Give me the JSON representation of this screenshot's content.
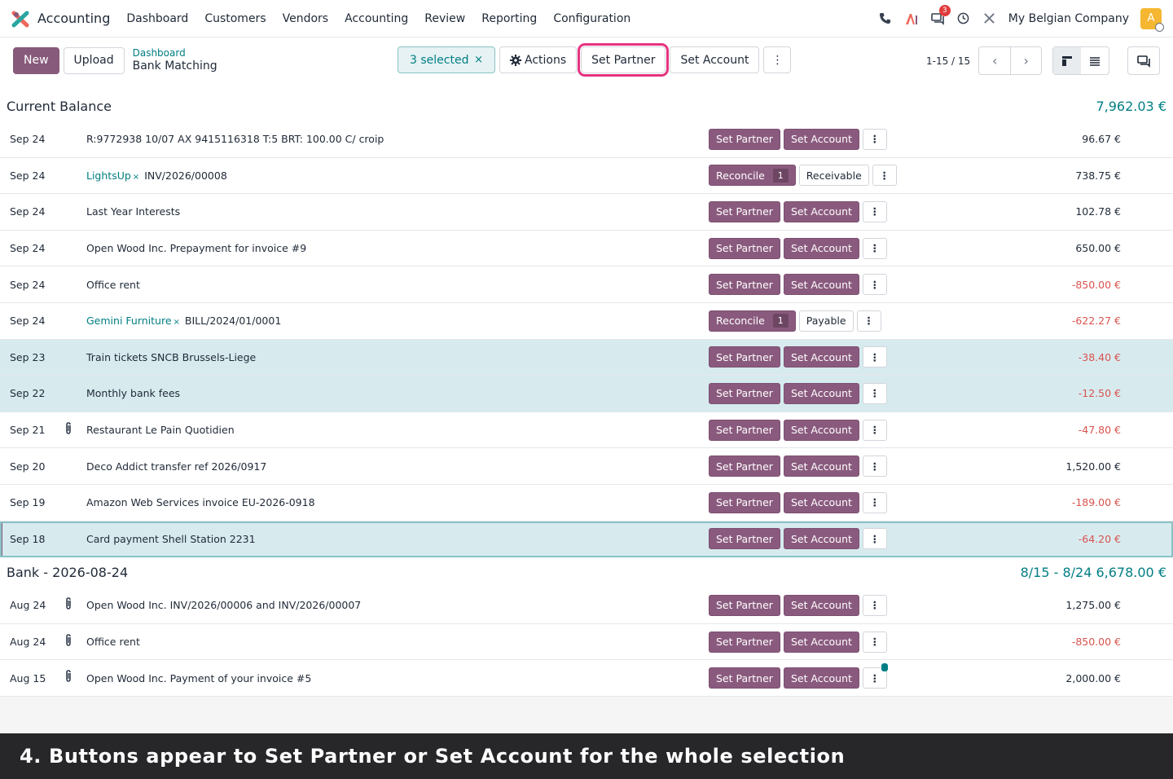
{
  "navbar": {
    "app_name": "Accounting",
    "menu": [
      "Dashboard",
      "Customers",
      "Vendors",
      "Accounting",
      "Review",
      "Reporting",
      "Configuration"
    ],
    "message_badge": "3",
    "company": "My Belgian Company",
    "avatar_letter": "A"
  },
  "controls": {
    "new_label": "New",
    "upload_label": "Upload",
    "breadcrumb_parent": "Dashboard",
    "breadcrumb_current": "Bank Matching",
    "selected_label": "3 selected",
    "selected_clear": "×",
    "actions_label": "Actions",
    "set_partner_label": "Set Partner",
    "set_account_label": "Set Account",
    "pager_text": "1-15 / 15"
  },
  "sections": [
    {
      "title": "Current Balance",
      "amount": "7,962.03 €",
      "rows": [
        {
          "date": "Sep 24",
          "attach": false,
          "partner": "",
          "label": "R:9772938 10/07 AX 9415116318 T:5 BRT: 100.00 C/ croip",
          "mode": "set",
          "amount": "96.67 €",
          "neg": false,
          "selected": false
        },
        {
          "date": "Sep 24",
          "attach": false,
          "partner": "LightsUp",
          "label": "INV/2026/00008",
          "mode": "reconcile",
          "count": "1",
          "account": "Receivable",
          "amount": "738.75 €",
          "neg": false,
          "selected": false
        },
        {
          "date": "Sep 24",
          "attach": false,
          "partner": "",
          "label": "Last Year Interests",
          "mode": "set",
          "amount": "102.78 €",
          "neg": false,
          "selected": false
        },
        {
          "date": "Sep 24",
          "attach": false,
          "partner": "",
          "label": "Open Wood Inc. Prepayment for invoice #9",
          "mode": "set",
          "amount": "650.00 €",
          "neg": false,
          "selected": false
        },
        {
          "date": "Sep 24",
          "attach": false,
          "partner": "",
          "label": "Office rent",
          "mode": "set",
          "amount": "-850.00 €",
          "neg": true,
          "selected": false
        },
        {
          "date": "Sep 24",
          "attach": false,
          "partner": "Gemini Furniture",
          "label": "BILL/2024/01/0001",
          "mode": "reconcile",
          "count": "1",
          "account": "Payable",
          "amount": "-622.27 €",
          "neg": true,
          "selected": false
        },
        {
          "date": "Sep 23",
          "attach": false,
          "partner": "",
          "label": "Train tickets SNCB Brussels-Liege",
          "mode": "set",
          "amount": "-38.40 €",
          "neg": true,
          "selected": true
        },
        {
          "date": "Sep 22",
          "attach": false,
          "partner": "",
          "label": "Monthly bank fees",
          "mode": "set",
          "amount": "-12.50 €",
          "neg": true,
          "selected": true
        },
        {
          "date": "Sep 21",
          "attach": true,
          "partner": "",
          "label": "Restaurant Le Pain Quotidien",
          "mode": "set",
          "amount": "-47.80 €",
          "neg": true,
          "selected": false
        },
        {
          "date": "Sep 20",
          "attach": false,
          "partner": "",
          "label": "Deco Addict transfer ref 2026/0917",
          "mode": "set",
          "amount": "1,520.00 €",
          "neg": false,
          "selected": false
        },
        {
          "date": "Sep 19",
          "attach": false,
          "partner": "",
          "label": "Amazon Web Services invoice EU-2026-0918",
          "mode": "set",
          "amount": "-189.00 €",
          "neg": true,
          "selected": false
        },
        {
          "date": "Sep 18",
          "attach": false,
          "partner": "",
          "label": "Card payment Shell Station 2231",
          "mode": "set",
          "amount": "-64.20 €",
          "neg": true,
          "selected": true,
          "focused": true
        }
      ]
    },
    {
      "title": "Bank - 2026-08-24",
      "amount": "8/15 - 8/24  6,678.00 €",
      "rows": [
        {
          "date": "Aug 24",
          "attach": true,
          "partner": "",
          "label": "Open Wood Inc. INV/2026/00006 and INV/2026/00007",
          "mode": "set",
          "amount": "1,275.00 €",
          "neg": false,
          "selected": false
        },
        {
          "date": "Aug 24",
          "attach": true,
          "partner": "",
          "label": "Office rent",
          "mode": "set",
          "amount": "-850.00 €",
          "neg": true,
          "selected": false
        },
        {
          "date": "Aug 15",
          "attach": true,
          "partner": "",
          "label": "Open Wood Inc. Payment of your invoice #5",
          "mode": "set",
          "amount": "2,000.00 €",
          "neg": false,
          "selected": false,
          "dot": true
        }
      ]
    }
  ],
  "row_buttons": {
    "set_partner": "Set Partner",
    "set_account": "Set Account",
    "reconcile": "Reconcile",
    "kebab": "⋮"
  },
  "caption": "4. Buttons appear to Set Partner or Set Account for the whole selection"
}
